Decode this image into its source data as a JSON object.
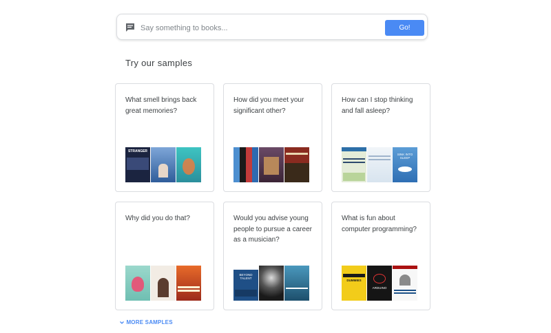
{
  "search": {
    "placeholder": "Say something to books...",
    "button_label": "Go!",
    "icon": "chat-bubble-icon"
  },
  "samples": {
    "heading": "Try our samples",
    "more_label": "MORE SAMPLES",
    "cards": [
      {
        "question": "What smell brings back great memories?",
        "books": [
          {
            "text": "STRANGER",
            "bg": "#1b2440",
            "fg": "#ffffff"
          },
          {
            "text": "",
            "bg": "#4e7fc0",
            "fg": "#ffffff"
          },
          {
            "text": "",
            "bg": "#3aaeb4",
            "fg": "#ffffff"
          }
        ]
      },
      {
        "question": "How did you meet your significant other?",
        "books": [
          {
            "text": "",
            "bg": "#2d5f96",
            "fg": "#ffffff"
          },
          {
            "text": "",
            "bg": "#5b3a52",
            "fg": "#ffffff"
          },
          {
            "text": "",
            "bg": "#7a2a1f",
            "fg": "#ffffff"
          }
        ]
      },
      {
        "question": "How can I stop thinking and fall asleep?",
        "books": [
          {
            "text": "",
            "bg": "#d9e6c9",
            "fg": "#2d4a6e"
          },
          {
            "text": "",
            "bg": "#e8eff6",
            "fg": "#5a7190"
          },
          {
            "text": "SINK INTO SLEEP",
            "bg": "#3f86c7",
            "fg": "#ffffff"
          }
        ]
      },
      {
        "question": "Why did you do that?",
        "books": [
          {
            "text": "",
            "bg": "#8fd0c4",
            "fg": "#4b2a2a"
          },
          {
            "text": "",
            "bg": "#efe9e1",
            "fg": "#5b3d2f"
          },
          {
            "text": "",
            "bg": "#d25a2c",
            "fg": "#fff3d4"
          }
        ]
      },
      {
        "question": "Would you advise young people to pursue a career as a musician?",
        "books": [
          {
            "text": "BEYOND TALENT",
            "bg": "#1f4f86",
            "fg": "#ffffff"
          },
          {
            "text": "",
            "bg": "#2a2a2a",
            "fg": "#ffffff"
          },
          {
            "text": "",
            "bg": "#3a80a0",
            "fg": "#ffffff"
          }
        ]
      },
      {
        "question": "What is fun about computer programming?",
        "books": [
          {
            "text": "DUMMIES",
            "bg": "#f2cc1a",
            "fg": "#1a1a1a"
          },
          {
            "text": "ARDUINO",
            "bg": "#151515",
            "fg": "#ffffff"
          },
          {
            "text": "",
            "bg": "#f5f5f5",
            "fg": "#1a4f86"
          }
        ]
      }
    ]
  }
}
